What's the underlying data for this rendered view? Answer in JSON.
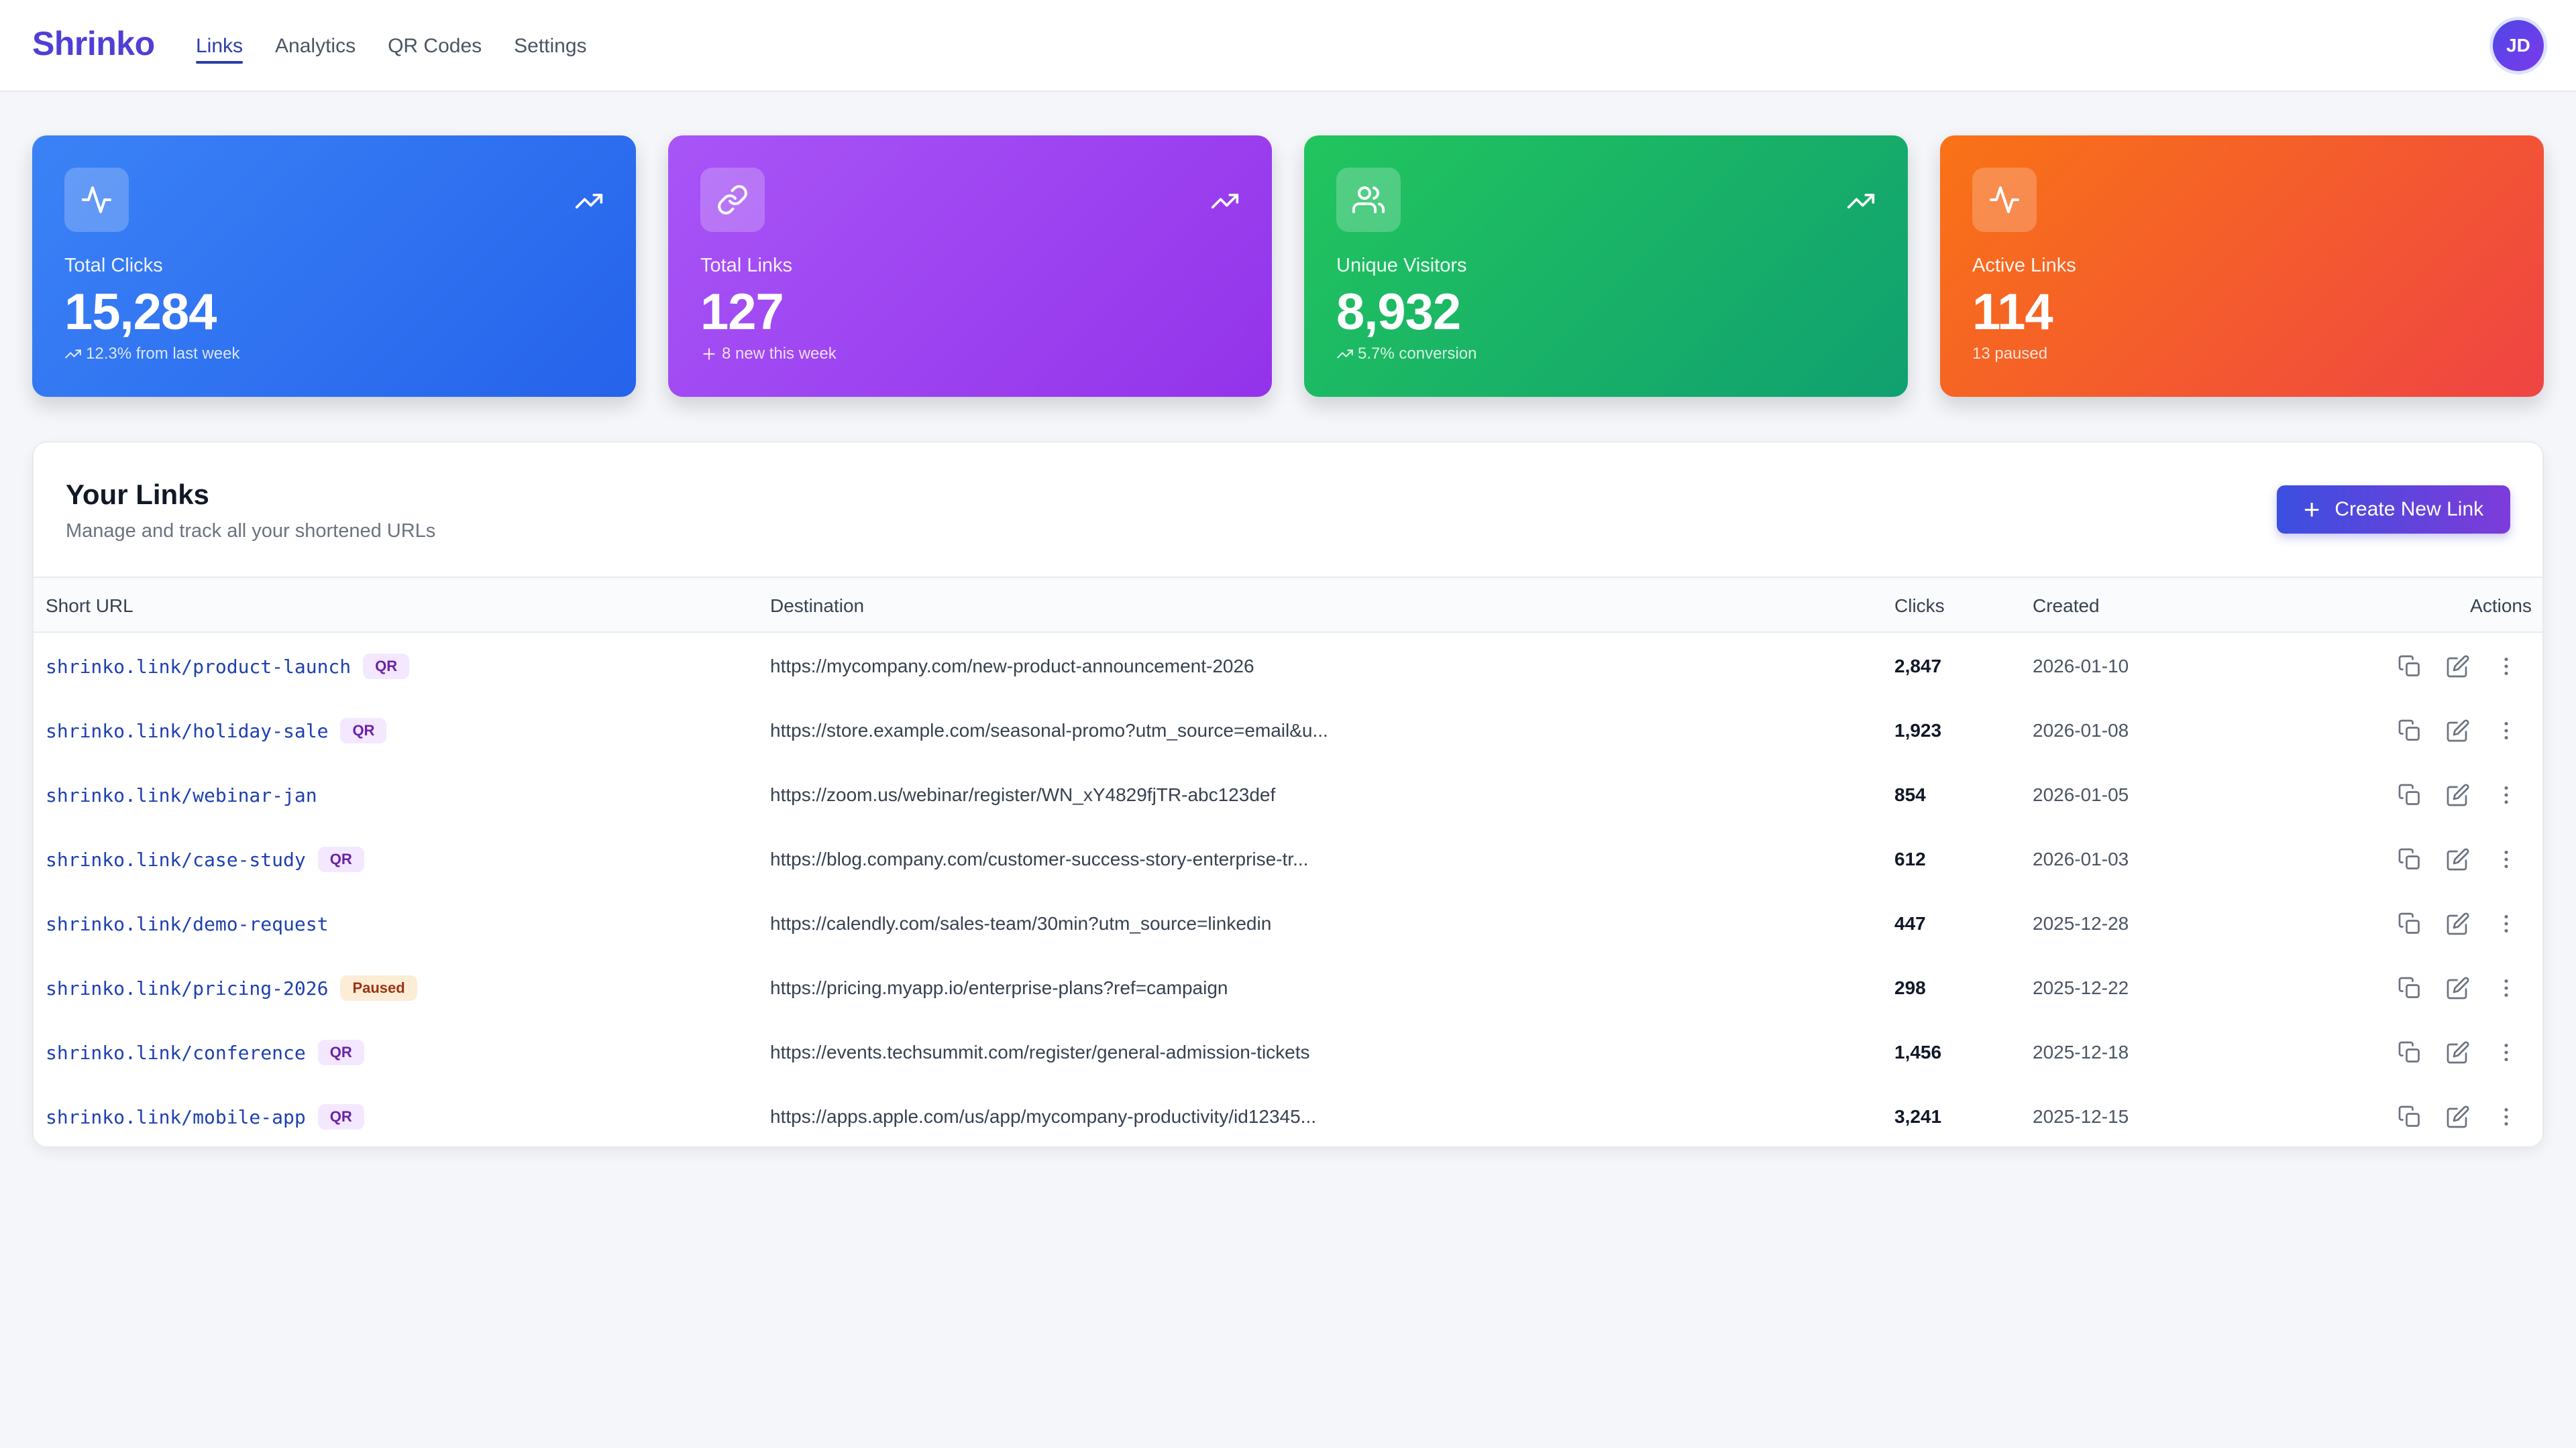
{
  "header": {
    "brand": "Shrinko",
    "nav": [
      "Links",
      "Analytics",
      "QR Codes",
      "Settings"
    ],
    "active_nav": "Links",
    "avatar_initials": "JD"
  },
  "stats": [
    {
      "icon": "activity-icon",
      "label": "Total Clicks",
      "value": "15,284",
      "sub": "12.3% from last week",
      "sub_icon": "trend-up-icon"
    },
    {
      "icon": "link-icon",
      "label": "Total Links",
      "value": "127",
      "sub": "8 new this week",
      "sub_icon": "plus-icon"
    },
    {
      "icon": "users-icon",
      "label": "Unique Visitors",
      "value": "8,932",
      "sub": "5.7% conversion",
      "sub_icon": "trend-up-icon"
    },
    {
      "icon": "activity-icon",
      "label": "Active Links",
      "value": "114",
      "sub": "13 paused",
      "sub_icon": ""
    }
  ],
  "links_panel": {
    "title": "Your Links",
    "subtitle": "Manage and track all your shortened URLs",
    "create_button": "Create New Link",
    "columns": [
      "Short URL",
      "Destination",
      "Clicks",
      "Created",
      "Actions"
    ],
    "rows": [
      {
        "short_url": "shrinko.link/product-launch",
        "badge": "QR",
        "destination": "https://mycompany.com/new-product-announcement-2026",
        "clicks": "2,847",
        "created": "2026-01-10"
      },
      {
        "short_url": "shrinko.link/holiday-sale",
        "badge": "QR",
        "destination": "https://store.example.com/seasonal-promo?utm_source=email&u...",
        "clicks": "1,923",
        "created": "2026-01-08"
      },
      {
        "short_url": "shrinko.link/webinar-jan",
        "badge": "",
        "destination": "https://zoom.us/webinar/register/WN_xY4829fjTR-abc123def",
        "clicks": "854",
        "created": "2026-01-05"
      },
      {
        "short_url": "shrinko.link/case-study",
        "badge": "QR",
        "destination": "https://blog.company.com/customer-success-story-enterprise-tr...",
        "clicks": "612",
        "created": "2026-01-03"
      },
      {
        "short_url": "shrinko.link/demo-request",
        "badge": "",
        "destination": "https://calendly.com/sales-team/30min?utm_source=linkedin",
        "clicks": "447",
        "created": "2025-12-28"
      },
      {
        "short_url": "shrinko.link/pricing-2026",
        "badge": "Paused",
        "destination": "https://pricing.myapp.io/enterprise-plans?ref=campaign",
        "clicks": "298",
        "created": "2025-12-22"
      },
      {
        "short_url": "shrinko.link/conference",
        "badge": "QR",
        "destination": "https://events.techsummit.com/register/general-admission-tickets",
        "clicks": "1,456",
        "created": "2025-12-18"
      },
      {
        "short_url": "shrinko.link/mobile-app",
        "badge": "QR",
        "destination": "https://apps.apple.com/us/app/mycompany-productivity/id12345...",
        "clicks": "3,241",
        "created": "2025-12-15"
      }
    ],
    "row_actions": [
      "copy-icon",
      "edit-icon",
      "more-vertical-icon"
    ]
  },
  "colors": {
    "brand": "#4f3fd6",
    "card_blue": "#2563eb",
    "card_purple": "#9333ea",
    "card_green": "#10a070",
    "card_orange": "#f97316",
    "qr_badge": "#f3e8ff",
    "paused_badge": "#fdecd6"
  }
}
